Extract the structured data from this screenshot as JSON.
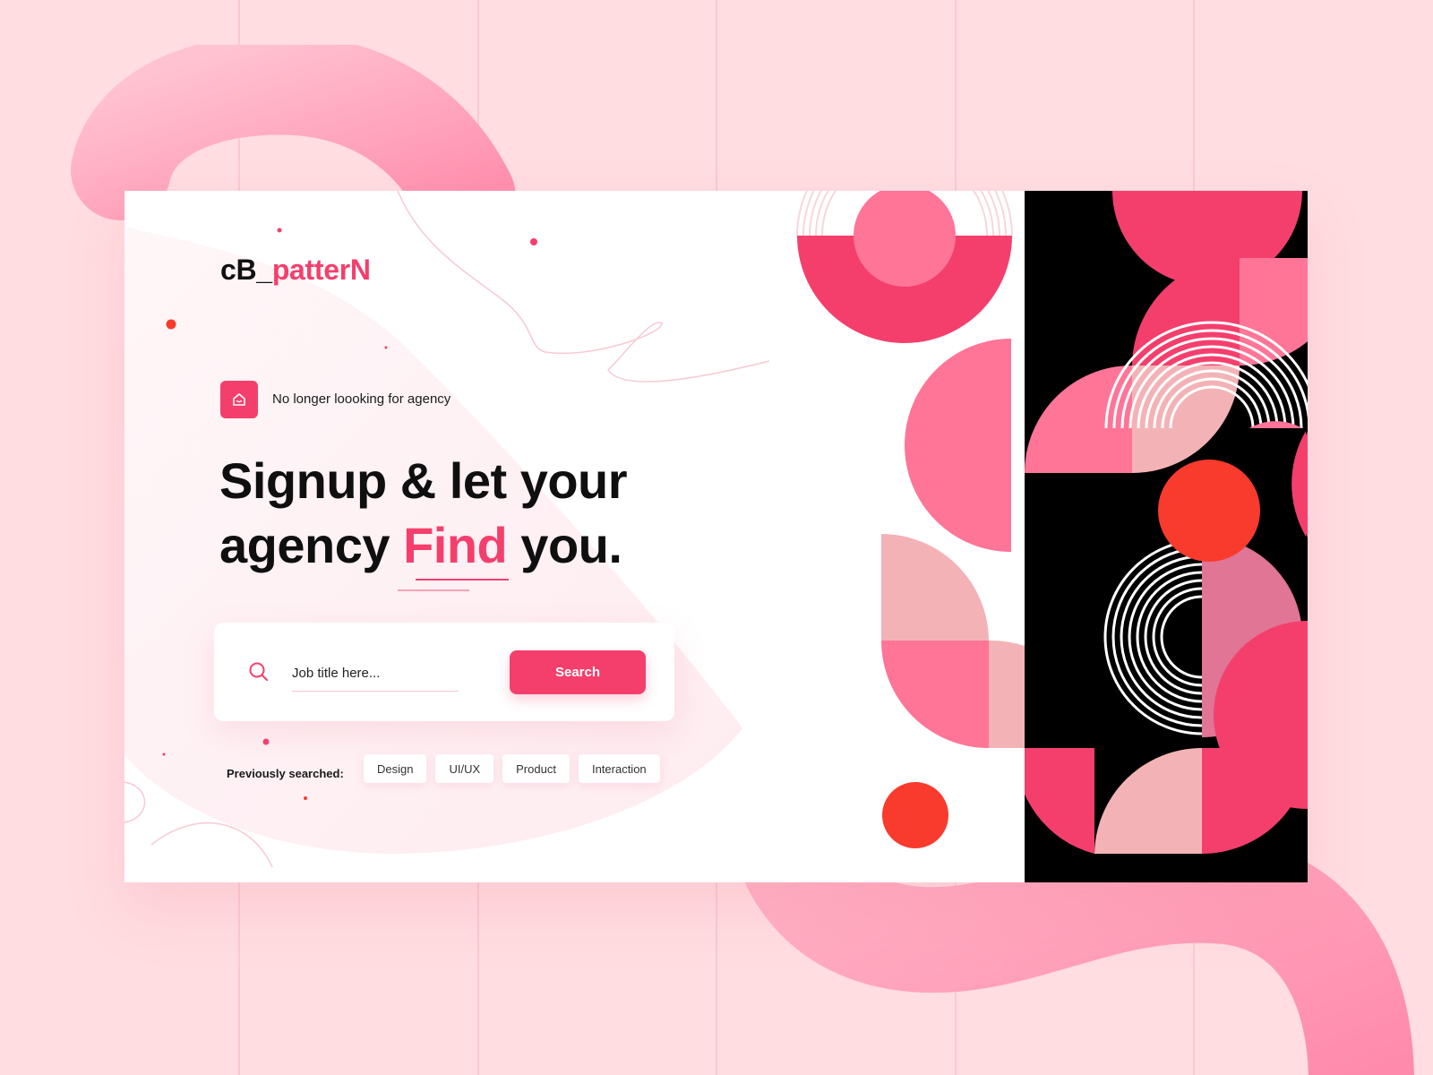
{
  "brand": {
    "logo_part1": "cB_",
    "logo_part2": "patterN"
  },
  "badge": {
    "icon": "home-icon",
    "text": "No longer loooking for agency"
  },
  "headline": {
    "line1": "Signup & let your",
    "line2_before": "agency ",
    "line2_accent": "Find",
    "line2_after": " you."
  },
  "search": {
    "icon": "search-icon",
    "placeholder": "Job title here...",
    "button_label": "Search"
  },
  "previously_searched": {
    "label": "Previously searched:",
    "tags": [
      "Design",
      "UI/UX",
      "Product",
      "Interaction"
    ]
  },
  "colors": {
    "accent": "#f43f6c",
    "background": "#ffdde1",
    "pink": "#ff7597",
    "light_pink": "#f3b3b6",
    "red_orange": "#f83b2d",
    "mauve": "#e07596",
    "black": "#000000"
  }
}
